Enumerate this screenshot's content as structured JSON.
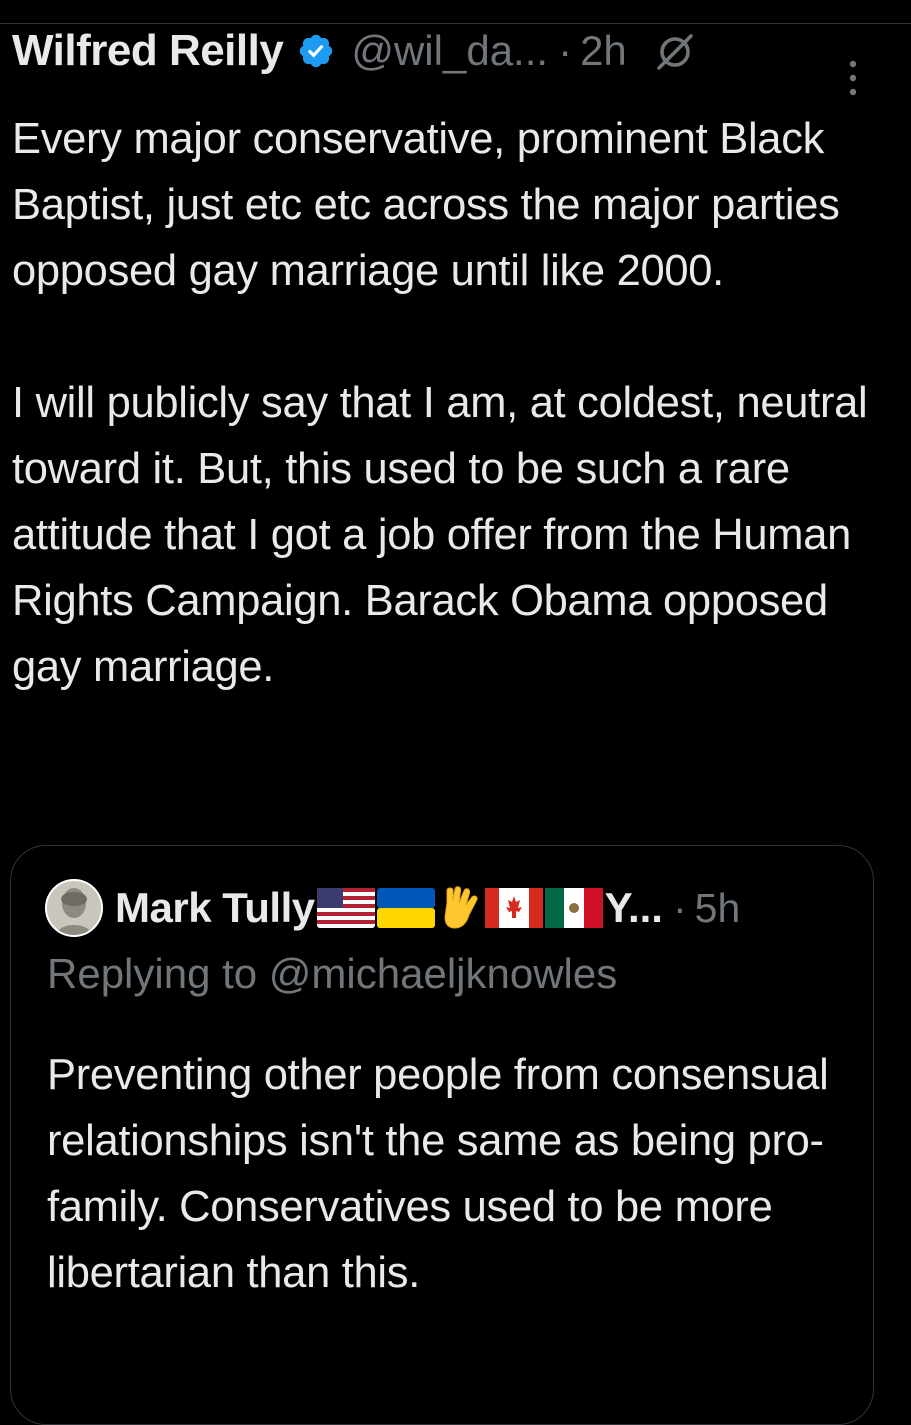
{
  "tweet": {
    "author_name": "Wilfred Reilly",
    "handle": "@wil_da...",
    "separator": "·",
    "time": "2h",
    "verified_icon": "verified-badge-icon",
    "grok_icon": "grok-icon",
    "more_icon": "more-options-icon",
    "body_paragraph_1": "Every major conservative, prominent Black Baptist, just etc etc across the major parties opposed gay marriage until like 2000.",
    "body_paragraph_2": "I will publicly say that I am, at coldest, neutral toward it. But, this used to be such a rare attitude that I got a job offer from the Human Rights Campaign. Barack Obama opposed gay marriage."
  },
  "quoted_tweet": {
    "author_name": "Mark Tully",
    "name_suffix": "Y...",
    "emojis": [
      "us-flag",
      "ukraine-flag",
      "vulcan-salute",
      "canada-flag",
      "mexico-flag"
    ],
    "separator": "·",
    "time": "5h",
    "replying_to": "Replying to @michaeljknowles",
    "body": "Preventing other people from consensual relationships isn't the same as being pro-family. Conservatives used to be more libertarian than this."
  },
  "colors": {
    "background": "#000000",
    "primary_text": "#e7e9ea",
    "secondary_text": "#71767b",
    "verified_blue": "#1d9bf0",
    "border": "#2f3336"
  }
}
